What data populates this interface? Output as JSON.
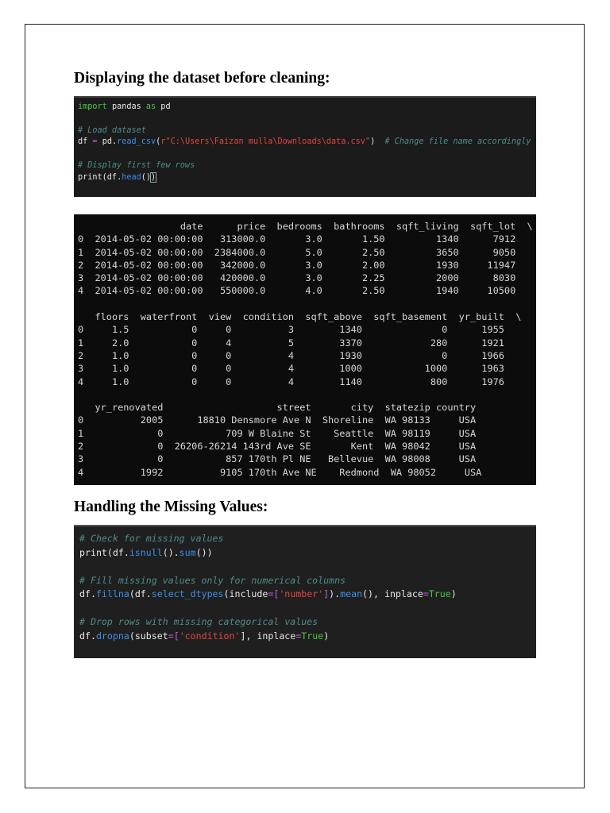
{
  "headings": {
    "before_cleaning": "Displaying the dataset before cleaning:",
    "missing_values": "Handling the Missing Values:"
  },
  "code_block_1": [
    [
      {
        "t": "import",
        "c": "kw"
      },
      {
        "t": " pandas ",
        "c": "tx"
      },
      {
        "t": "as",
        "c": "kw"
      },
      {
        "t": " pd",
        "c": "tx"
      }
    ],
    [],
    [
      {
        "t": "# Load dataset",
        "c": "cm"
      }
    ],
    [
      {
        "t": "df ",
        "c": "tx"
      },
      {
        "t": "=",
        "c": "op"
      },
      {
        "t": " pd.",
        "c": "tx"
      },
      {
        "t": "read_csv",
        "c": "fn"
      },
      {
        "t": "(",
        "c": "tx"
      },
      {
        "t": "r\"C:\\Users\\Faizan mulla\\Downloads\\data.csv\"",
        "c": "str"
      },
      {
        "t": ")  ",
        "c": "tx"
      },
      {
        "t": "# Change file name accordingly",
        "c": "cm"
      }
    ],
    [],
    [
      {
        "t": "# Display first few rows",
        "c": "cm"
      }
    ],
    [
      {
        "t": "print(df.",
        "c": "tx"
      },
      {
        "t": "head",
        "c": "fn"
      },
      {
        "t": "()",
        "c": "tx"
      },
      {
        "t": ")",
        "c": "cur"
      }
    ]
  ],
  "output_lines": [
    "                  date      price  bedrooms  bathrooms  sqft_living  sqft_lot  \\",
    "0  2014-05-02 00:00:00   313000.0       3.0       1.50         1340      7912",
    "1  2014-05-02 00:00:00  2384000.0       5.0       2.50         3650      9050",
    "2  2014-05-02 00:00:00   342000.0       3.0       2.00         1930     11947",
    "3  2014-05-02 00:00:00   420000.0       3.0       2.25         2000      8030",
    "4  2014-05-02 00:00:00   550000.0       4.0       2.50         1940     10500",
    "",
    "   floors  waterfront  view  condition  sqft_above  sqft_basement  yr_built  \\",
    "0     1.5           0     0          3        1340              0      1955",
    "1     2.0           0     4          5        3370            280      1921",
    "2     1.0           0     0          4        1930              0      1966",
    "3     1.0           0     0          4        1000           1000      1963",
    "4     1.0           0     0          4        1140            800      1976",
    "",
    "   yr_renovated                    street       city  statezip country",
    "0          2005      18810 Densmore Ave N  Shoreline  WA 98133     USA",
    "1             0           709 W Blaine St    Seattle  WA 98119     USA",
    "2             0  26206-26214 143rd Ave SE       Kent  WA 98042     USA",
    "3             0           857 170th Pl NE   Bellevue  WA 98008     USA",
    "4          1992          9105 170th Ave NE    Redmond  WA 98052     USA"
  ],
  "code_block_2": [
    [
      {
        "t": "# Check for missing values",
        "c": "cm"
      }
    ],
    [
      {
        "t": "print(df.",
        "c": "tx"
      },
      {
        "t": "isnull",
        "c": "fn"
      },
      {
        "t": "().",
        "c": "tx"
      },
      {
        "t": "sum",
        "c": "fn"
      },
      {
        "t": "())",
        "c": "tx"
      }
    ],
    [],
    [
      {
        "t": "# Fill missing values only for numerical columns",
        "c": "cm"
      }
    ],
    [
      {
        "t": "df.",
        "c": "tx"
      },
      {
        "t": "fillna",
        "c": "fn"
      },
      {
        "t": "(df.",
        "c": "tx"
      },
      {
        "t": "select_dtypes",
        "c": "fn"
      },
      {
        "t": "(include",
        "c": "tx"
      },
      {
        "t": "=[",
        "c": "op"
      },
      {
        "t": "'number'",
        "c": "str"
      },
      {
        "t": "]",
        "c": "op"
      },
      {
        "t": ").",
        "c": "tx"
      },
      {
        "t": "mean",
        "c": "fn"
      },
      {
        "t": "(), inplace",
        "c": "tx"
      },
      {
        "t": "=",
        "c": "op"
      },
      {
        "t": "True",
        "c": "bool"
      },
      {
        "t": ")",
        "c": "tx"
      }
    ],
    [],
    [
      {
        "t": "# Drop rows with missing categorical values",
        "c": "cm"
      }
    ],
    [
      {
        "t": "df.",
        "c": "tx"
      },
      {
        "t": "dropna",
        "c": "fn"
      },
      {
        "t": "(subset",
        "c": "tx"
      },
      {
        "t": "=[",
        "c": "op"
      },
      {
        "t": "'condition'",
        "c": "str"
      },
      {
        "t": "], inplace",
        "c": "tx"
      },
      {
        "t": "=",
        "c": "op"
      },
      {
        "t": "True",
        "c": "bool"
      },
      {
        "t": ")",
        "c": "tx"
      }
    ]
  ]
}
